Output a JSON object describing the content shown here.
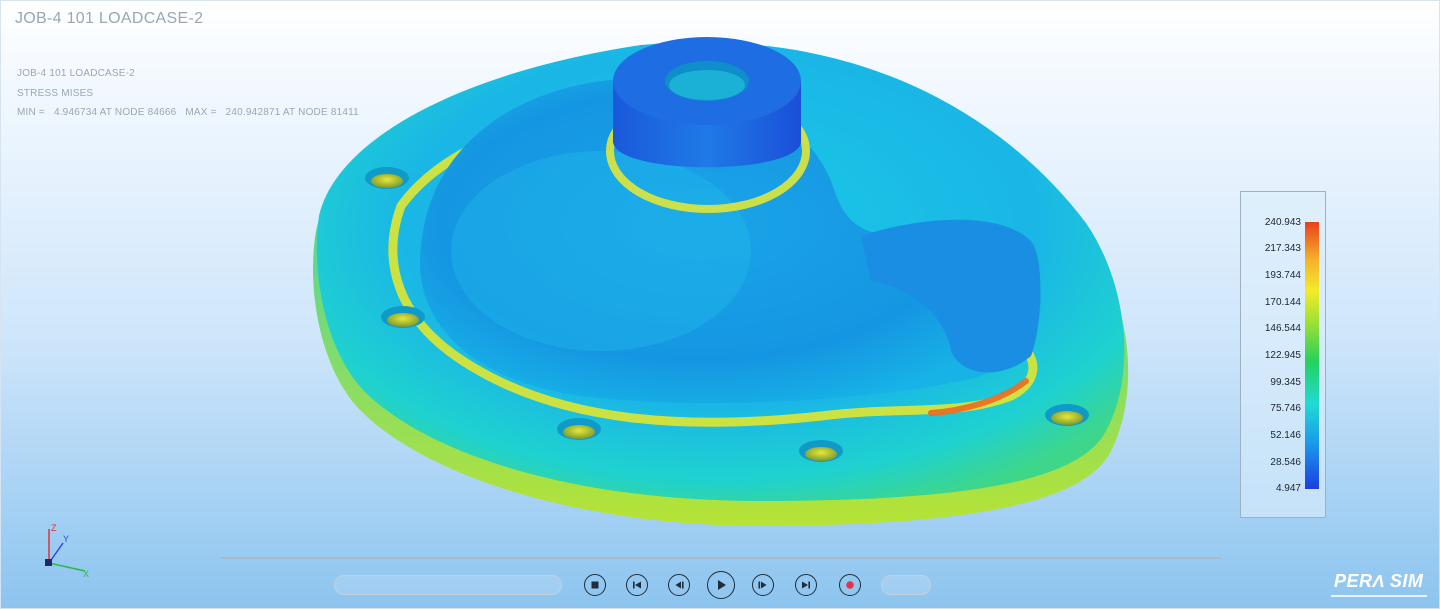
{
  "window": {
    "title": "JOB-4 101 LOADCASE-2"
  },
  "info": {
    "job": "JOB-4 101 LOADCASE-2",
    "result": "STRESS MISES",
    "min_label": "MIN =",
    "min_value": "4.946734 AT NODE 84666",
    "max_label": "MAX =",
    "max_value": "240.942871 AT NODE 81411"
  },
  "legend": {
    "values": [
      "240.943",
      "217.343",
      "193.744",
      "170.144",
      "146.544",
      "122.945",
      "99.345",
      "75.746",
      "52.146",
      "28.546",
      "4.947"
    ],
    "colors": [
      "#e8401a",
      "#f5b12a",
      "#f2ec2a",
      "#9ae035",
      "#25d15c",
      "#20dbd4",
      "#1a9eea",
      "#1d3ee0"
    ]
  },
  "playback": {
    "buttons": [
      "stop",
      "skip-to-start",
      "step-back",
      "play",
      "step-forward",
      "skip-to-end",
      "record"
    ]
  },
  "axes": {
    "x": "X",
    "y": "Y",
    "z": "Z"
  },
  "brand": {
    "logo": "PERΛ SIM"
  }
}
